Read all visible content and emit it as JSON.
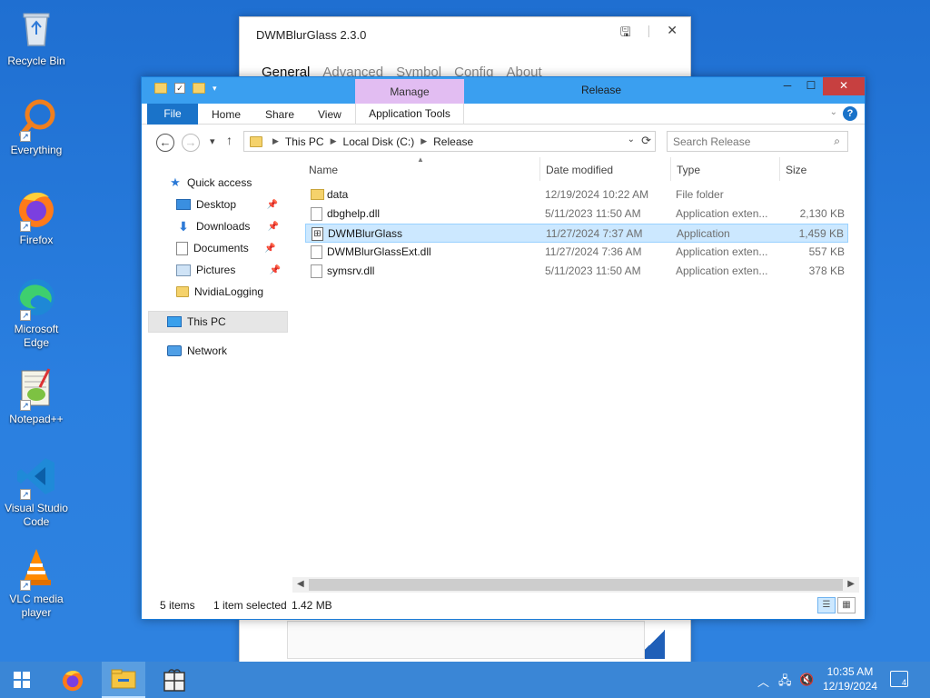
{
  "desktop": {
    "icons": [
      {
        "label": "Recycle Bin"
      },
      {
        "label": "Everything"
      },
      {
        "label": "Firefox"
      },
      {
        "label": "Microsoft Edge"
      },
      {
        "label": "Notepad++"
      },
      {
        "label": "Visual Studio Code"
      },
      {
        "label": "VLC media player"
      }
    ]
  },
  "bg_dialog": {
    "title": "DWMBlurGlass 2.3.0",
    "tabs": [
      "General",
      "Advanced",
      "Symbol",
      "Config",
      "About"
    ]
  },
  "explorer": {
    "title": "Release",
    "manage_tab": "Manage",
    "ribbon": {
      "file": "File",
      "home": "Home",
      "share": "Share",
      "view": "View",
      "app_tools": "Application Tools"
    },
    "address": {
      "crumbs": [
        "This PC",
        "Local Disk (C:)",
        "Release"
      ]
    },
    "search": {
      "placeholder": "Search Release"
    },
    "nav_pane": {
      "quick_access": "Quick access",
      "items": [
        "Desktop",
        "Downloads",
        "Documents",
        "Pictures",
        "NvidiaLogging"
      ],
      "this_pc": "This PC",
      "network": "Network"
    },
    "columns": {
      "name": "Name",
      "date": "Date modified",
      "type": "Type",
      "size": "Size"
    },
    "files": [
      {
        "name": "data",
        "date": "12/19/2024 10:22 AM",
        "type": "File folder",
        "size": ""
      },
      {
        "name": "dbghelp.dll",
        "date": "5/11/2023 11:50 AM",
        "type": "Application exten...",
        "size": "2,130 KB"
      },
      {
        "name": "DWMBlurGlass",
        "date": "11/27/2024 7:37 AM",
        "type": "Application",
        "size": "1,459 KB"
      },
      {
        "name": "DWMBlurGlassExt.dll",
        "date": "11/27/2024 7:36 AM",
        "type": "Application exten...",
        "size": "557 KB"
      },
      {
        "name": "symsrv.dll",
        "date": "5/11/2023 11:50 AM",
        "type": "Application exten...",
        "size": "378 KB"
      }
    ],
    "status": {
      "items": "5 items",
      "selection": "1 item selected",
      "size": "1.42 MB"
    }
  },
  "taskbar": {
    "time": "10:35 AM",
    "date": "12/19/2024",
    "notifications": "4"
  }
}
